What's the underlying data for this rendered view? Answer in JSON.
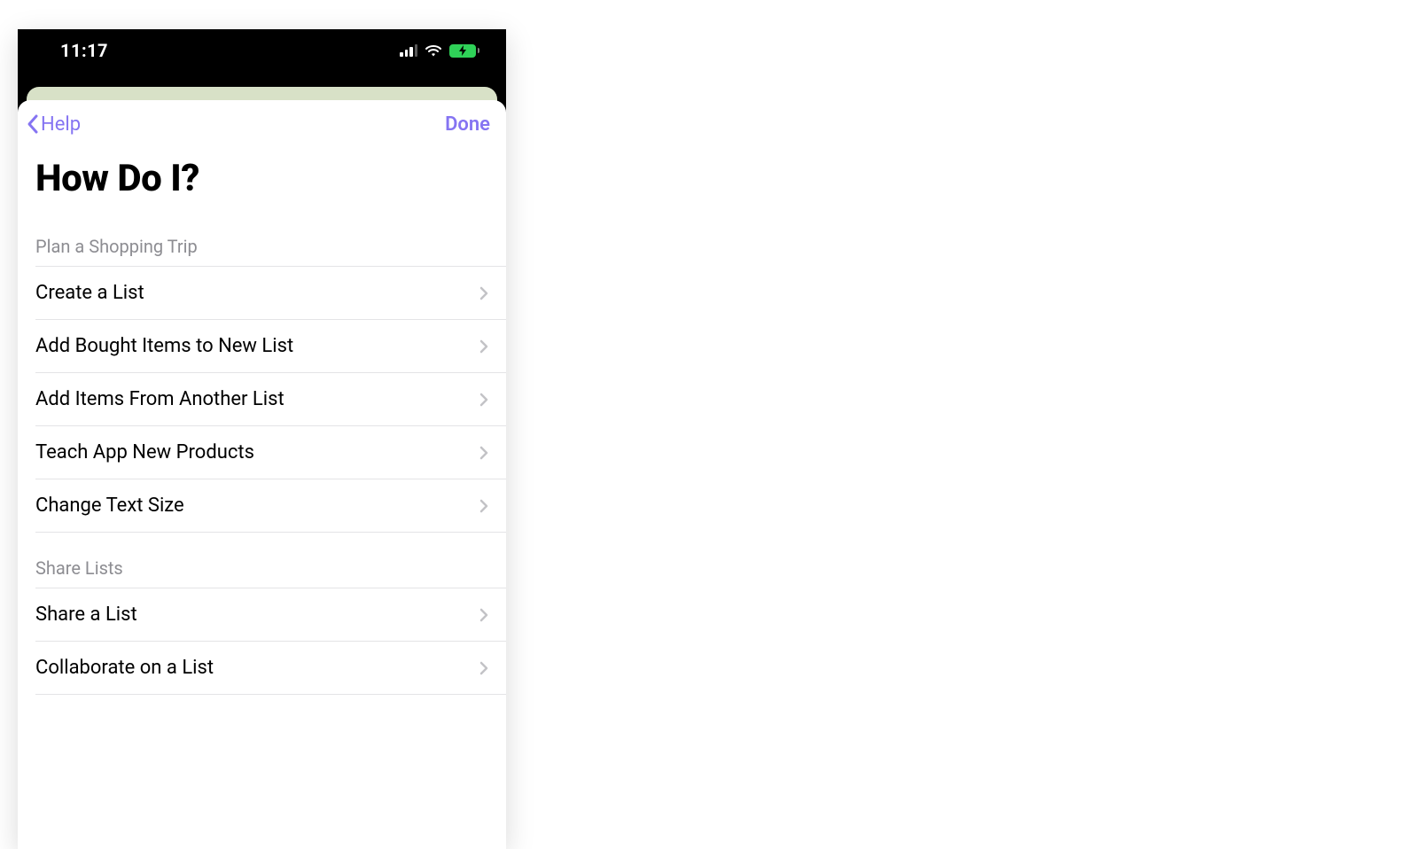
{
  "status": {
    "time": "11:17"
  },
  "nav": {
    "back_label": "Help",
    "done_label": "Done"
  },
  "page": {
    "title": "How Do I?"
  },
  "sections": [
    {
      "header": "Plan a Shopping Trip",
      "items": [
        {
          "label": "Create a List"
        },
        {
          "label": "Add Bought Items to New List"
        },
        {
          "label": "Add Items From Another List"
        },
        {
          "label": "Teach App New Products"
        },
        {
          "label": "Change Text Size"
        }
      ]
    },
    {
      "header": "Share Lists",
      "items": [
        {
          "label": "Share a List"
        },
        {
          "label": "Collaborate on a List"
        }
      ]
    }
  ]
}
